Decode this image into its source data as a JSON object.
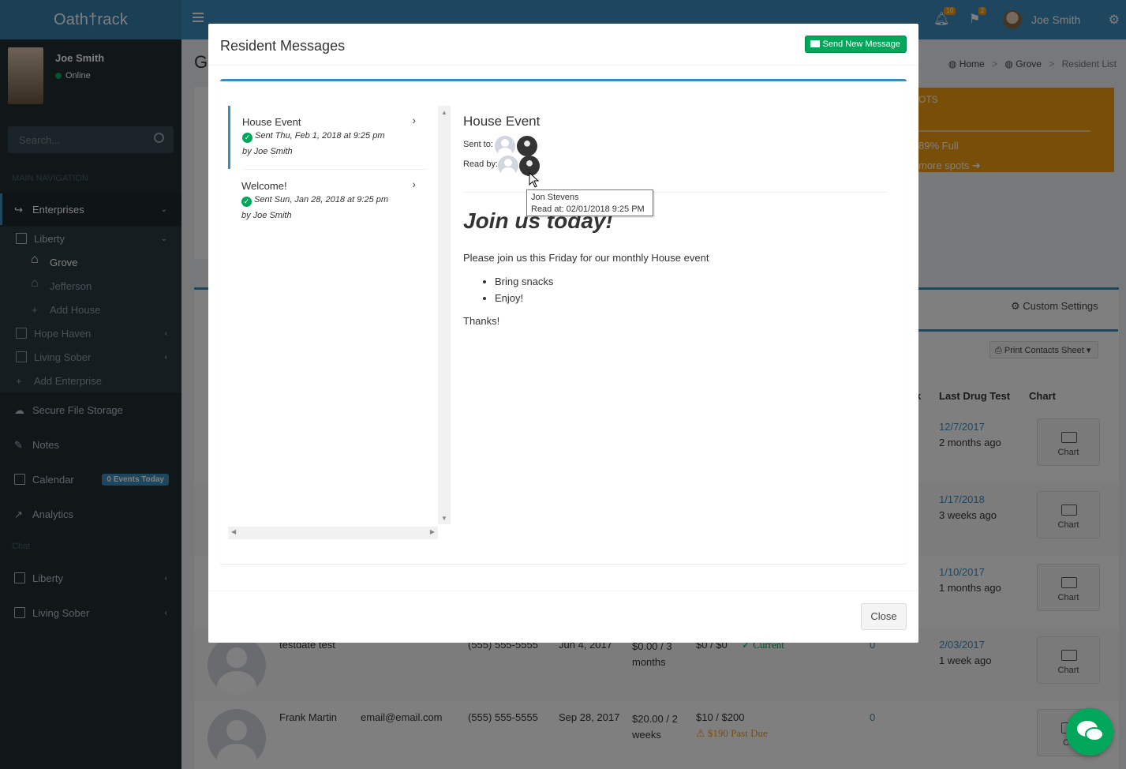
{
  "app": {
    "logo": "Oath†rack"
  },
  "topbar": {
    "notifications_count": "10",
    "flags_count": "2",
    "user_name": "Joe Smith"
  },
  "sidebar": {
    "user": {
      "name": "Joe Smith",
      "status": "Online"
    },
    "search_placeholder": "Search...",
    "main_header": "MAIN NAVIGATION",
    "chat_header": "Chat",
    "items": {
      "enterprises": "Enterprises",
      "liberty": "Liberty",
      "grove": "Grove",
      "jefferson": "Jefferson",
      "add_house": "Add House",
      "hope_haven": "Hope Haven",
      "living_sober": "Living Sober",
      "add_enterprise": "Add Enterprise",
      "secure_file_storage": "Secure File Storage",
      "notes": "Notes",
      "calendar": "Calendar",
      "calendar_badge": "0 Events Today",
      "analytics": "Analytics",
      "chat_liberty": "Liberty",
      "chat_living_sober": "Living Sober"
    }
  },
  "background": {
    "page_title": "Gr",
    "breadcrumb": {
      "home": "Home",
      "grove": "Grove",
      "current": "Resident List"
    },
    "yellow_box": {
      "label": "OTS",
      "fullness": "89% Full",
      "more": "more spots"
    },
    "custom_settings": "Custom Settings",
    "print_button": "Print Contacts Sheet",
    "table_headers": {
      "k": "k",
      "last_drug_test": "Last Drug Test",
      "chart": "Chart"
    },
    "rows": [
      {
        "drug_date": "12/7/2017",
        "drug_ago": "2 months ago",
        "chart": "Chart"
      },
      {
        "drug_date": "1/17/2018",
        "drug_ago": "3 weeks ago",
        "chart": "Chart"
      },
      {
        "drug_date": "1/10/2017",
        "drug_ago": "1 months ago",
        "chart": "Chart"
      },
      {
        "name": "testdate test",
        "phone": "(555) 555-5555",
        "start": "Jun 4, 2017",
        "rent": "$0.00 / 3 months",
        "balance": "$0 / $0",
        "status": "Current",
        "count": "0",
        "drug_date": "2/03/2017",
        "drug_ago": "1 week ago",
        "chart": "Chart"
      },
      {
        "name": "Frank Martin",
        "email": "email@email.com",
        "phone": "(555) 555-5555",
        "start": "Sep 28, 2017",
        "rent": "$20.00 / 2 weeks",
        "balance": "$10 / $200",
        "status": "$190 Past Due",
        "count": "0",
        "chart": "Ch"
      }
    ]
  },
  "modal": {
    "title": "Resident Messages",
    "send_button": "Send New Message",
    "messages": [
      {
        "subject": "House Event",
        "sent": "Sent Thu, Feb 1, 2018 at 9:25 pm",
        "by": "by Joe Smith"
      },
      {
        "subject": "Welcome!",
        "sent": "Sent Sun, Jan 28, 2018 at 9:25 pm",
        "by": "by Joe Smith"
      }
    ],
    "detail": {
      "subject": "House Event",
      "sent_to_label": "Sent to:",
      "read_by_label": "Read by:",
      "tooltip_name": "Jon Stevens",
      "tooltip_read": "Read at: 02/01/2018 9:25 PM",
      "heading": "Join us today!",
      "paragraph": "Please join us this Friday for our monthly House event",
      "bullets": [
        "Bring snacks",
        "Enjoy!"
      ],
      "closing": "Thanks!"
    },
    "close_button": "Close"
  },
  "colors": {
    "primary": "#3c8dbc",
    "success": "#00a65a",
    "warning": "#f39c12",
    "sidebar_bg": "#222d32"
  }
}
